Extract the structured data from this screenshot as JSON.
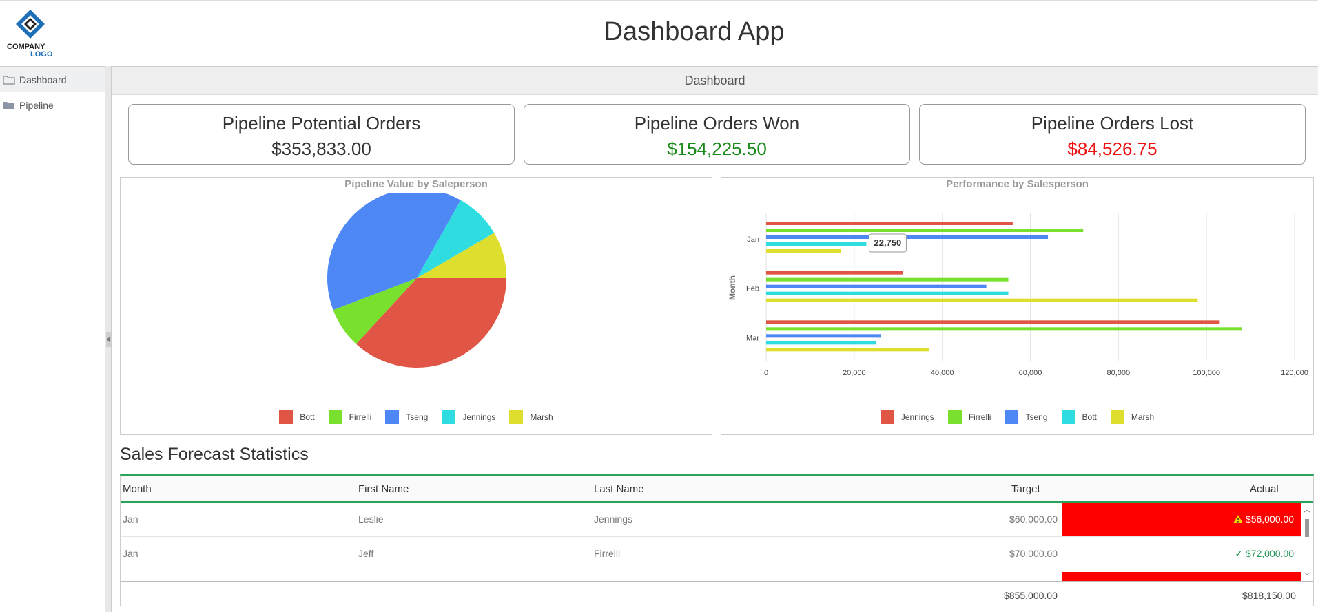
{
  "header": {
    "logo_line1": "COMPANY",
    "logo_line2": "LOGO",
    "title": "Dashboard App"
  },
  "sidebar": {
    "items": [
      {
        "label": "Dashboard",
        "icon": "folder-open-icon",
        "active": true
      },
      {
        "label": "Pipeline",
        "icon": "folder-icon",
        "active": false
      }
    ]
  },
  "tab": {
    "label": "Dashboard"
  },
  "kpis": [
    {
      "title": "Pipeline Potential Orders",
      "value": "$353,833.00",
      "color": "#333333"
    },
    {
      "title": "Pipeline Orders Won",
      "value": "$154,225.50",
      "color": "#1b8a1b"
    },
    {
      "title": "Pipeline Orders Lost",
      "value": "$84,526.75",
      "color": "#ee1111"
    }
  ],
  "chart_data": [
    {
      "type": "pie",
      "title": "Pipeline Value by Saleperson",
      "legend_position": "bottom",
      "slices": [
        {
          "name": "Bott",
          "value": 35,
          "color": "#e05545"
        },
        {
          "name": "Firrelli",
          "value": 7,
          "color": "#7ae02e"
        },
        {
          "name": "Tseng",
          "value": 37,
          "color": "#4d88f5"
        },
        {
          "name": "Jennings",
          "value": 8,
          "color": "#2fdde0"
        },
        {
          "name": "Marsh",
          "value": 8,
          "color": "#dede2e"
        }
      ]
    },
    {
      "type": "bar",
      "orientation": "horizontal",
      "title": "Performance by Salesperson",
      "ylabel": "Month",
      "xlabel": "",
      "categories": [
        "Jan",
        "Feb",
        "Mar"
      ],
      "xlim": [
        0,
        120000
      ],
      "xticks": [
        "0",
        "20,000",
        "40,000",
        "60,000",
        "80,000",
        "100,000",
        "120,000"
      ],
      "grid": true,
      "legend_position": "bottom",
      "tooltip": {
        "series": "Bott",
        "category": "Jan",
        "label": "22,750"
      },
      "series": [
        {
          "name": "Jennings",
          "color": "#e05545",
          "values": [
            56000,
            31000,
            103000
          ]
        },
        {
          "name": "Firrelli",
          "color": "#7ae02e",
          "values": [
            72000,
            55000,
            108000
          ]
        },
        {
          "name": "Tseng",
          "color": "#4d88f5",
          "values": [
            64000,
            50000,
            26000
          ]
        },
        {
          "name": "Bott",
          "color": "#2fdde0",
          "values": [
            22750,
            55000,
            25000
          ]
        },
        {
          "name": "Marsh",
          "color": "#dede2e",
          "values": [
            17000,
            98000,
            37000
          ]
        }
      ]
    }
  ],
  "grid": {
    "title": "Sales Forecast Statistics",
    "columns": [
      "Month",
      "First Name",
      "Last Name",
      "Target",
      "Actual"
    ],
    "rows": [
      {
        "month": "Jan",
        "first": "Leslie",
        "last": "Jennings",
        "target": "$60,000.00",
        "actual": "$56,000.00",
        "status": "below"
      },
      {
        "month": "Jan",
        "first": "Jeff",
        "last": "Firrelli",
        "target": "$70,000.00",
        "actual": "$72,000.00",
        "status": "above"
      }
    ],
    "footer": {
      "target": "$855,000.00",
      "actual": "$818,150.00"
    },
    "colors": {
      "below": "#ff0000",
      "above_text": "#2a9a5a",
      "accent": "#2aa35a"
    }
  }
}
